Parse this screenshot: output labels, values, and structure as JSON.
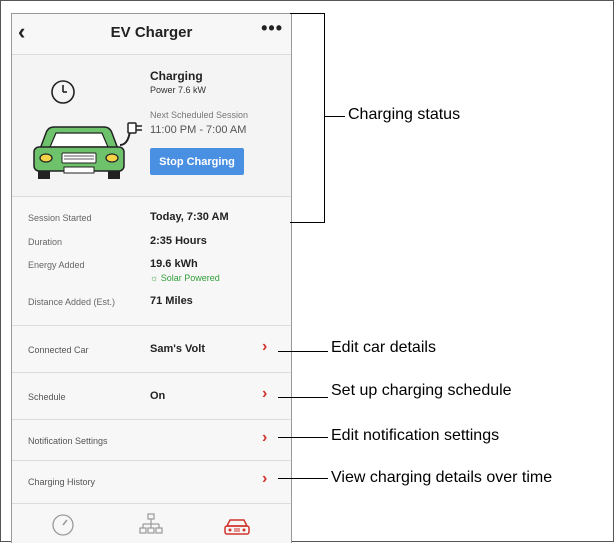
{
  "header": {
    "back_glyph": "‹",
    "title": "EV Charger",
    "more_glyph": "•••"
  },
  "status": {
    "state": "Charging",
    "power": "Power 7.6 kW",
    "next_label": "Next Scheduled Session",
    "next_value": "11:00 PM - 7:00 AM",
    "stop_button": "Stop Charging"
  },
  "details": {
    "session_started_label": "Session Started",
    "session_started_value": "Today, 7:30 AM",
    "duration_label": "Duration",
    "duration_value": "2:35 Hours",
    "energy_label": "Energy Added",
    "energy_value": "19.6 kWh",
    "solar_note": "☼ Solar Powered",
    "distance_label": "Distance Added  (Est.)",
    "distance_value": "71 Miles"
  },
  "rows": [
    {
      "label": "Connected Car",
      "value": "Sam's Volt"
    },
    {
      "label": "Schedule",
      "value": "On"
    },
    {
      "label": "Notification Settings",
      "value": ""
    },
    {
      "label": "Charging History",
      "value": ""
    }
  ],
  "chevron": "›",
  "annotations": {
    "charging_status": "Charging status",
    "edit_car": "Edit car details",
    "setup_schedule": "Set up charging schedule",
    "edit_notifications": "Edit notification settings",
    "view_history": "View charging details over time"
  },
  "colors": {
    "accent_blue": "#4a90e2",
    "chevron_red": "#d0342c",
    "car_green": "#6ec26b",
    "solar_green": "#33a03a"
  },
  "icons": [
    "clock-icon",
    "car-plug-icon",
    "gauge-icon",
    "network-icon",
    "car-icon"
  ]
}
